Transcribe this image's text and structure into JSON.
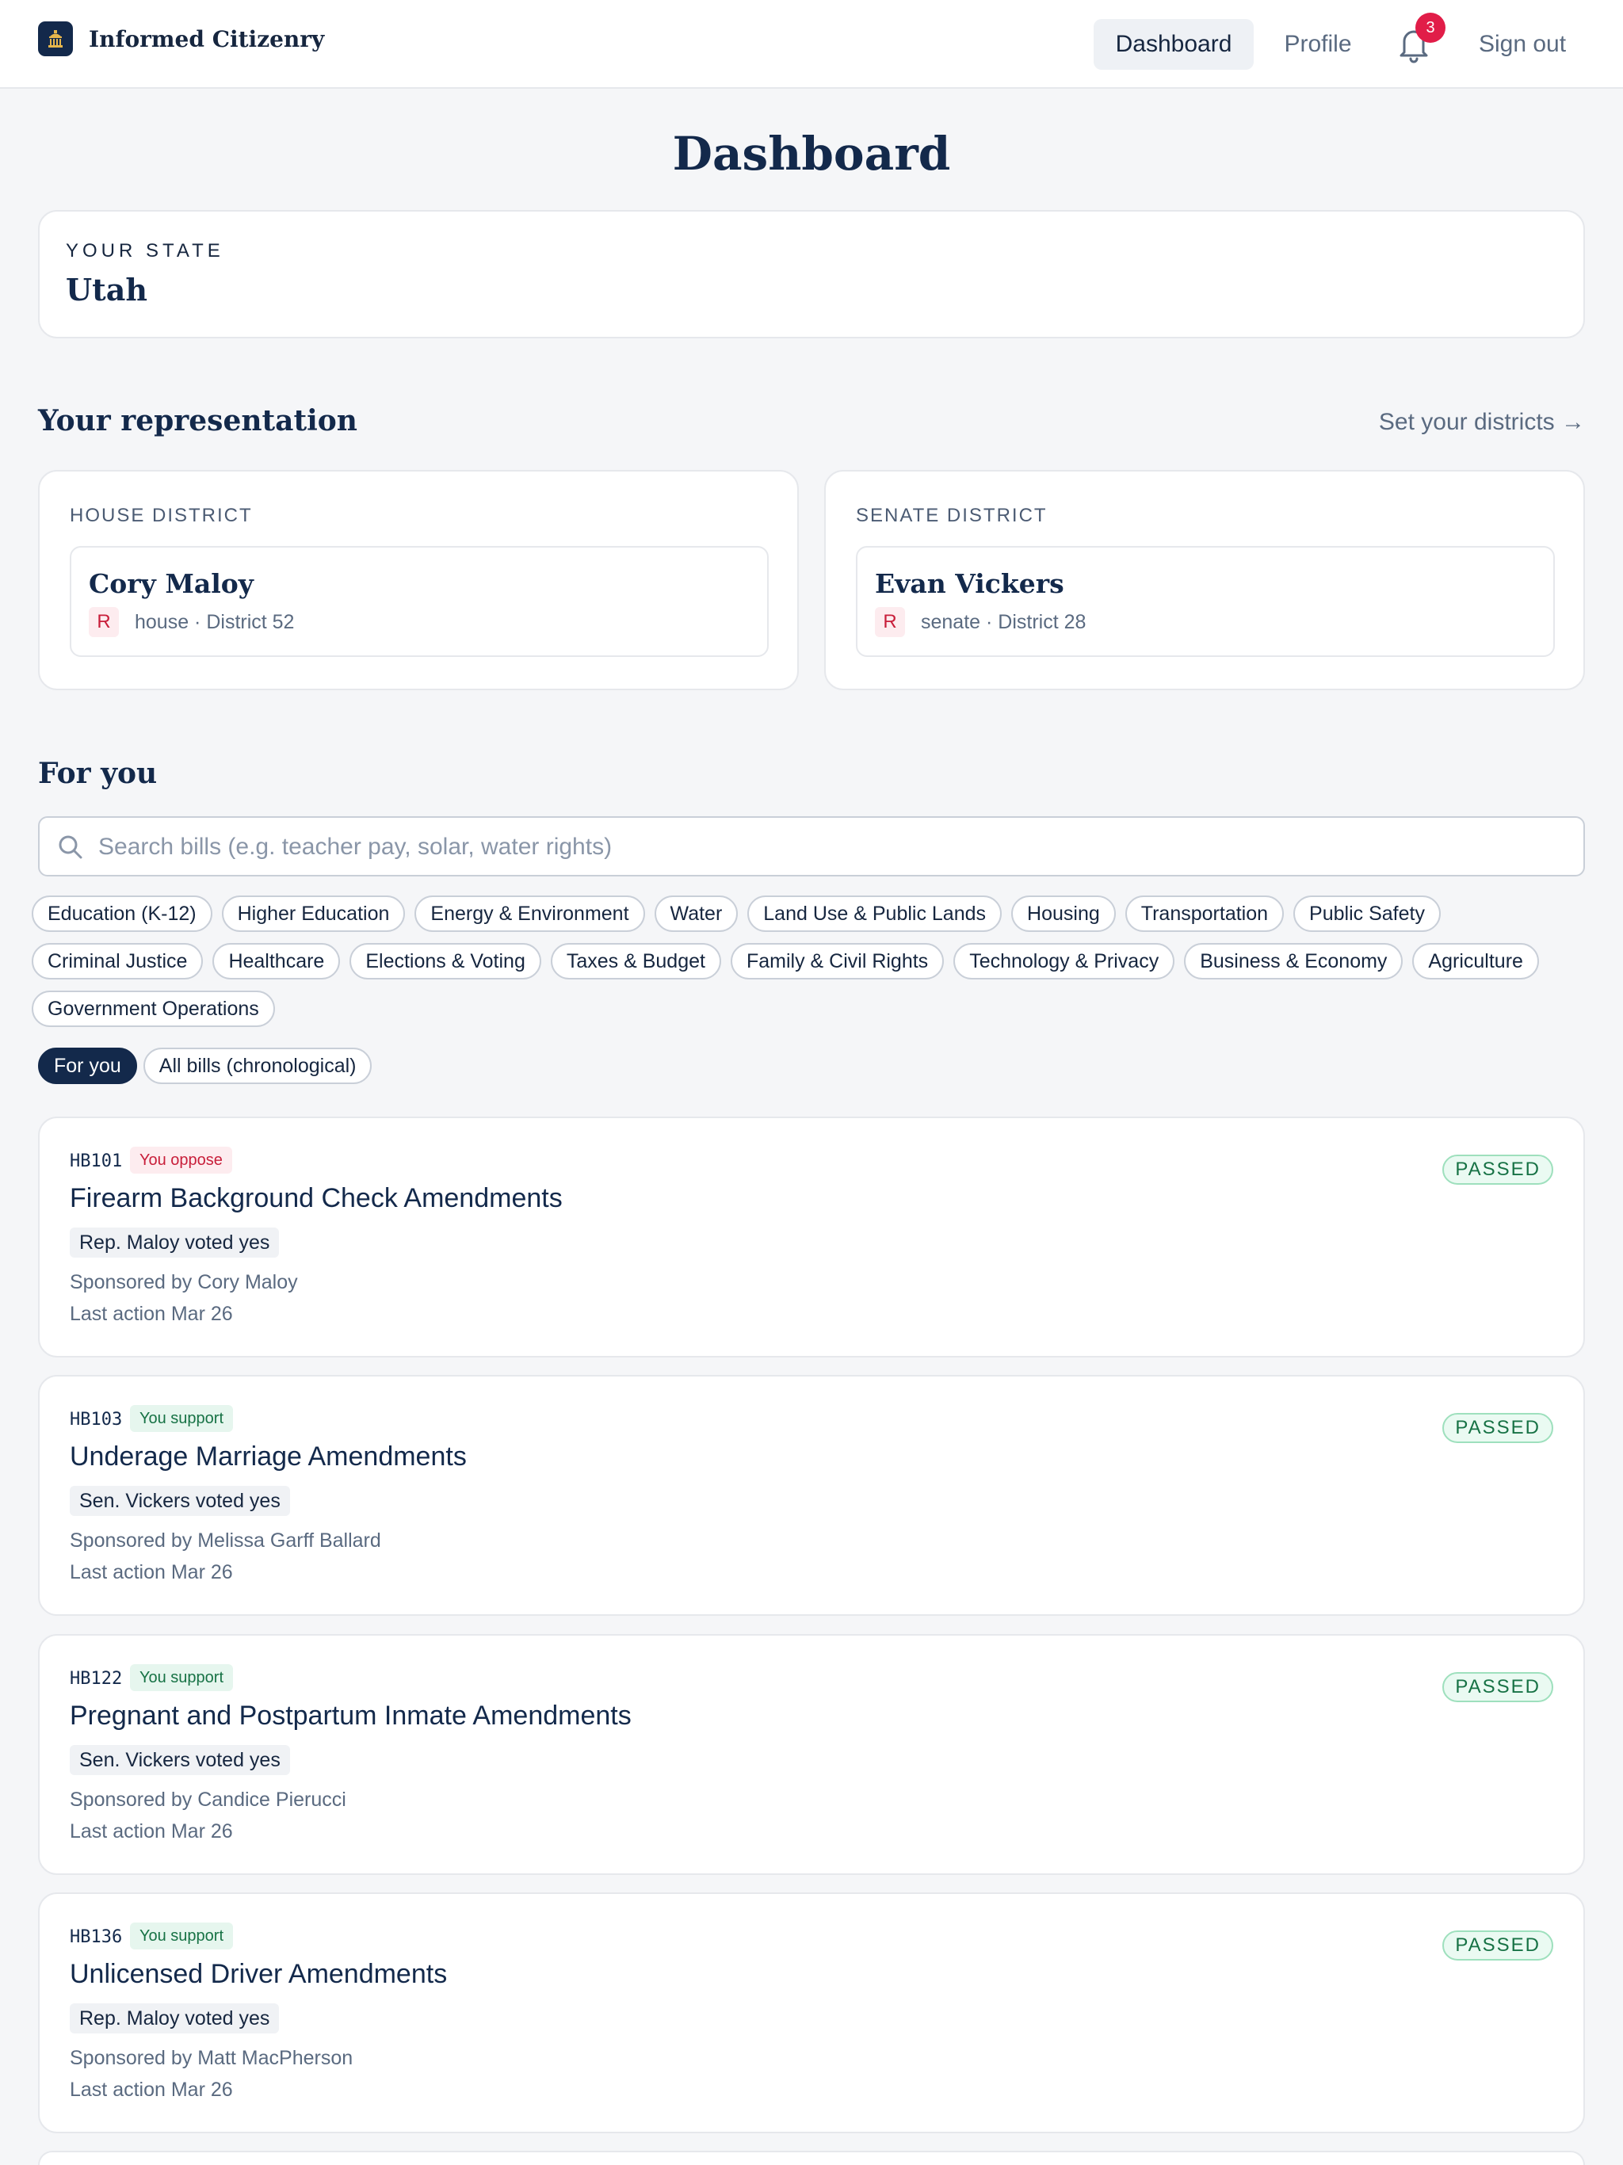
{
  "nav": {
    "brand": "Informed Citizenry",
    "dashboard": "Dashboard",
    "profile": "Profile",
    "notifications_count": "3",
    "sign_out": "Sign out"
  },
  "page": {
    "title": "Dashboard"
  },
  "state": {
    "label": "YOUR STATE",
    "value": "Utah"
  },
  "representation": {
    "title": "Your representation",
    "set_districts": "Set your districts →",
    "house": {
      "label": "HOUSE DISTRICT",
      "name": "Cory Maloy",
      "party": "R",
      "meta": "house · District 52"
    },
    "senate": {
      "label": "SENATE DISTRICT",
      "name": "Evan Vickers",
      "party": "R",
      "meta": "senate · District 28"
    }
  },
  "for_you": {
    "title": "For you",
    "search_placeholder": "Search bills (e.g. teacher pay, solar, water rights)",
    "topics": [
      "Education (K-12)",
      "Higher Education",
      "Energy & Environment",
      "Water",
      "Land Use & Public Lands",
      "Housing",
      "Transportation",
      "Public Safety",
      "Criminal Justice",
      "Healthcare",
      "Elections & Voting",
      "Taxes & Budget",
      "Family & Civil Rights",
      "Technology & Privacy",
      "Business & Economy",
      "Agriculture",
      "Government Operations"
    ],
    "views": {
      "for_you": "For you",
      "all": "All bills (chronological)"
    }
  },
  "bills": [
    {
      "id": "HB101",
      "stance": "You oppose",
      "title": "Firearm Background Check Amendments",
      "vote": "Rep. Maloy voted yes",
      "sponsor": "Sponsored by Cory Maloy",
      "last_action": "Last action Mar 26",
      "status": "PASSED"
    },
    {
      "id": "HB103",
      "stance": "You support",
      "title": "Underage Marriage Amendments",
      "vote": "Sen. Vickers voted yes",
      "sponsor": "Sponsored by Melissa Garff Ballard",
      "last_action": "Last action Mar 26",
      "status": "PASSED"
    },
    {
      "id": "HB122",
      "stance": "You support",
      "title": "Pregnant and Postpartum Inmate Amendments",
      "vote": "Sen. Vickers voted yes",
      "sponsor": "Sponsored by Candice Pierucci",
      "last_action": "Last action Mar 26",
      "status": "PASSED"
    },
    {
      "id": "HB136",
      "stance": "You support",
      "title": "Unlicensed Driver Amendments",
      "vote": "Rep. Maloy voted yes",
      "sponsor": "Sponsored by Matt MacPherson",
      "last_action": "Last action Mar 26",
      "status": "PASSED"
    }
  ]
}
